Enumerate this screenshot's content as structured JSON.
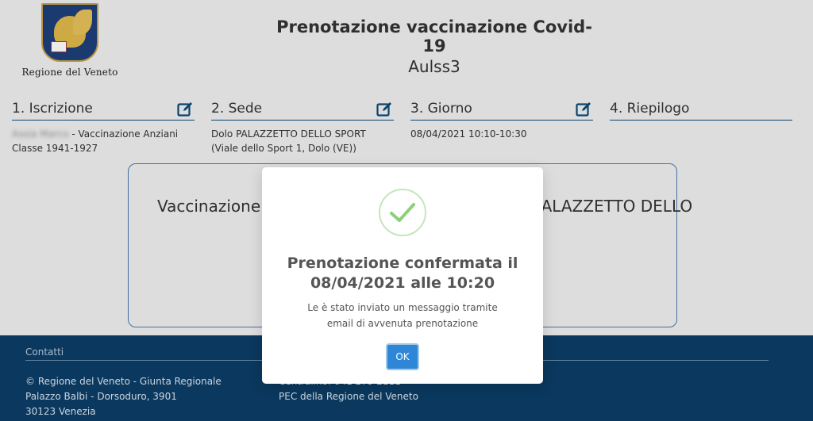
{
  "header": {
    "logo_text": "Regione del Veneto",
    "title": "Prenotazione vaccinazione Covid-19",
    "subtitle": "Aulss3"
  },
  "steps": [
    {
      "label": "1. Iscrizione",
      "name_blurred": "Assia Marco",
      "text": " - Vaccinazione Anziani Classe 1941-1927",
      "icon": "edit-icon"
    },
    {
      "label": "2. Sede",
      "text": "Dolo PALAZZETTO DELLO SPORT (Viale dello Sport 1, Dolo (VE))",
      "icon": "edit-icon"
    },
    {
      "label": "3. Giorno",
      "text": "08/04/2021 10:10-10:30",
      "icon": "edit-icon"
    },
    {
      "label": "4. Riepilogo"
    }
  ],
  "card": {
    "text": "Vaccinazione Anziani Classe 1941-1927 a Dolo PALAZZETTO DELLO"
  },
  "footer": {
    "contacts_label": "Contatti",
    "left_lines": [
      "© Regione del Veneto - Giunta Regionale",
      "Palazzo Balbi - Dorsoduro, 3901",
      "30123 Venezia"
    ],
    "right_lines": [
      "Centralino: 041 279 2111",
      "PEC della Regione del Veneto"
    ]
  },
  "modal": {
    "icon": "check-icon",
    "title": "Prenotazione confermata il 08/04/2021 alle 10:20",
    "message": "Le è stato inviato un messaggio tramite email di avvenuta prenotazione",
    "ok_label": "OK"
  },
  "colors": {
    "accent": "#0b3d66",
    "button": "#2f86d6",
    "success": "#8dcf7a"
  }
}
